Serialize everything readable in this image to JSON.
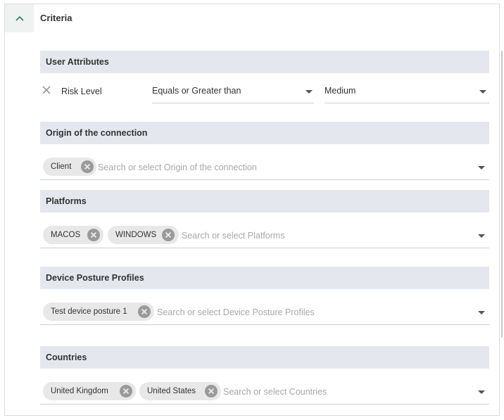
{
  "header": {
    "title": "Criteria"
  },
  "user_attributes": {
    "title": "User Attributes",
    "row": {
      "label": "Risk Level",
      "operator": "Equals or Greater than",
      "value": "Medium"
    }
  },
  "origin": {
    "title": "Origin of the connection",
    "chips": [
      "Client"
    ],
    "placeholder": "Search or select Origin of the connection"
  },
  "platforms": {
    "title": "Platforms",
    "chips": [
      "MACOS",
      "WINDOWS"
    ],
    "placeholder": "Search or select Platforms"
  },
  "device_posture": {
    "title": "Device Posture Profiles",
    "chips": [
      "Test device posture 1"
    ],
    "placeholder": "Search or select Device Posture Profiles"
  },
  "countries": {
    "title": "Countries",
    "chips": [
      "United Kingdom",
      "United States"
    ],
    "placeholder": "Search or select Countries"
  },
  "colors": {
    "accent": "#2e7d5b",
    "section_bg": "#e4e8ee",
    "chip_bg": "#e8e8e8"
  }
}
